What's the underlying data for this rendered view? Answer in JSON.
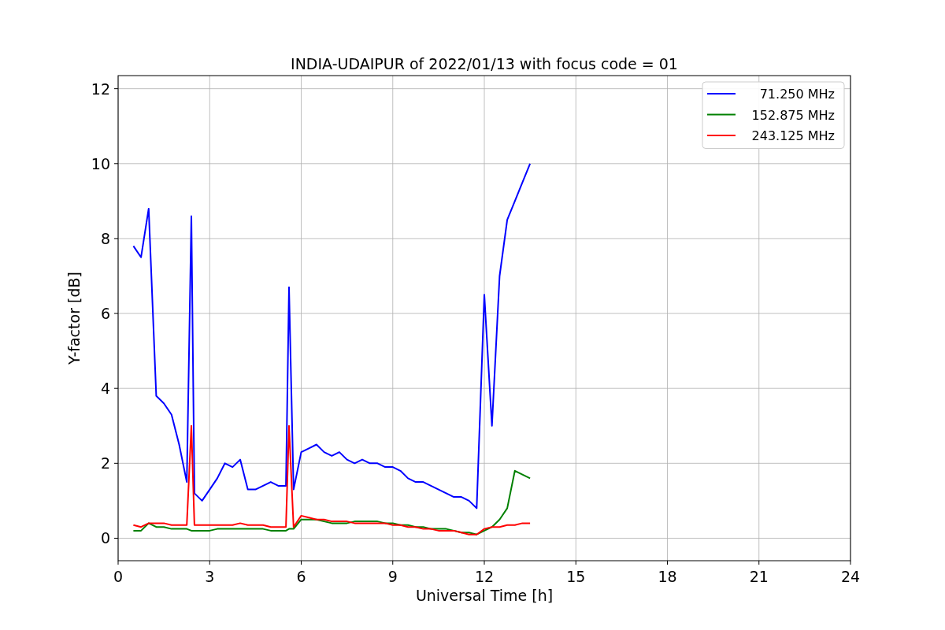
{
  "chart_data": {
    "type": "line",
    "title": "INDIA-UDAIPUR of 2022/01/13 with focus code = 01",
    "xlabel": "Universal Time [h]",
    "ylabel": "Y-factor [dB]",
    "x": [
      0.5,
      0.75,
      1,
      1.25,
      1.5,
      1.75,
      2,
      2.25,
      2.4,
      2.5,
      2.75,
      3,
      3.25,
      3.5,
      3.75,
      4,
      4.25,
      4.5,
      4.75,
      5,
      5.25,
      5.5,
      5.6,
      5.75,
      6,
      6.25,
      6.5,
      6.75,
      7,
      7.25,
      7.5,
      7.75,
      8,
      8.25,
      8.5,
      8.75,
      9,
      9.25,
      9.5,
      9.75,
      10,
      10.25,
      10.5,
      10.75,
      11,
      11.25,
      11.5,
      11.75,
      12,
      12.25,
      12.5,
      12.75,
      13,
      13.25,
      13.5
    ],
    "series": [
      {
        "name": "71.250 MHz",
        "color": "#0000ff",
        "values": [
          7.8,
          7.5,
          8.8,
          3.8,
          3.6,
          3.3,
          2.5,
          1.5,
          8.6,
          1.2,
          1.0,
          1.3,
          1.6,
          2.0,
          1.9,
          2.1,
          1.3,
          1.3,
          1.4,
          1.5,
          1.4,
          1.4,
          6.7,
          1.3,
          2.3,
          2.4,
          2.5,
          2.3,
          2.2,
          2.3,
          2.1,
          2.0,
          2.1,
          2.0,
          2.0,
          1.9,
          1.9,
          1.8,
          1.6,
          1.5,
          1.5,
          1.4,
          1.3,
          1.2,
          1.1,
          1.1,
          1.0,
          0.8,
          6.5,
          3.0,
          7.0,
          8.5,
          9.0,
          9.5,
          10.0
        ]
      },
      {
        "name": "152.875 MHz",
        "color": "#008000",
        "values": [
          0.2,
          0.2,
          0.4,
          0.3,
          0.3,
          0.25,
          0.25,
          0.25,
          0.2,
          0.2,
          0.2,
          0.2,
          0.25,
          0.25,
          0.25,
          0.25,
          0.25,
          0.25,
          0.25,
          0.2,
          0.2,
          0.2,
          0.25,
          0.25,
          0.5,
          0.5,
          0.5,
          0.45,
          0.4,
          0.4,
          0.4,
          0.45,
          0.45,
          0.45,
          0.45,
          0.4,
          0.4,
          0.35,
          0.35,
          0.3,
          0.3,
          0.25,
          0.25,
          0.25,
          0.2,
          0.15,
          0.15,
          0.1,
          0.2,
          0.3,
          0.5,
          0.8,
          1.8,
          1.7,
          1.6
        ]
      },
      {
        "name": "243.125 MHz",
        "color": "#ff0000",
        "values": [
          0.35,
          0.3,
          0.4,
          0.4,
          0.4,
          0.35,
          0.35,
          0.35,
          3.0,
          0.35,
          0.35,
          0.35,
          0.35,
          0.35,
          0.35,
          0.4,
          0.35,
          0.35,
          0.35,
          0.3,
          0.3,
          0.3,
          3.0,
          0.3,
          0.6,
          0.55,
          0.5,
          0.5,
          0.45,
          0.45,
          0.45,
          0.4,
          0.4,
          0.4,
          0.4,
          0.4,
          0.35,
          0.35,
          0.3,
          0.3,
          0.25,
          0.25,
          0.2,
          0.2,
          0.2,
          0.15,
          0.1,
          0.1,
          0.25,
          0.3,
          0.3,
          0.35,
          0.35,
          0.4,
          0.4
        ]
      }
    ],
    "xlim": [
      0,
      24
    ],
    "ylim": [
      -0.6,
      12.35
    ],
    "xticks": [
      0,
      3,
      6,
      9,
      12,
      15,
      18,
      21,
      24
    ],
    "yticks": [
      0,
      2,
      4,
      6,
      8,
      10,
      12
    ],
    "grid": true,
    "legend": true
  }
}
